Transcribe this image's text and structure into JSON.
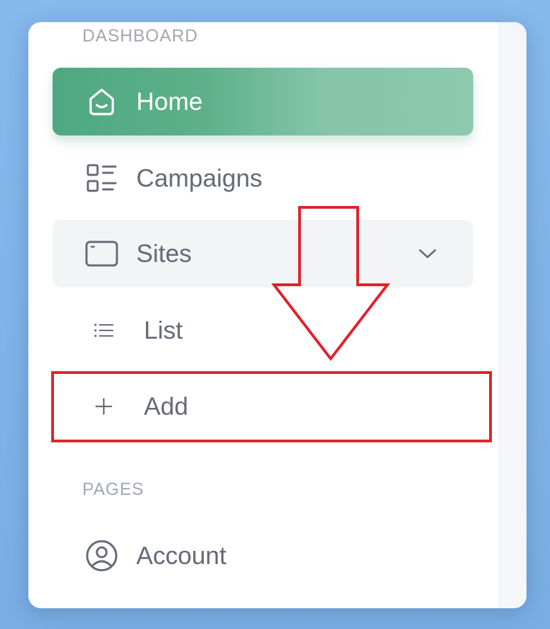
{
  "sidebar": {
    "sections": [
      {
        "label": "DASHBOARD"
      },
      {
        "label": "PAGES"
      }
    ],
    "items": [
      {
        "label": "Home",
        "icon": "home-icon",
        "active": true
      },
      {
        "label": "Campaigns",
        "icon": "campaigns-grid-icon",
        "active": false
      },
      {
        "label": "Sites",
        "icon": "browser-window-icon",
        "expanded": true
      },
      {
        "label": "Account",
        "icon": "user-circle-icon",
        "active": false
      }
    ],
    "sites_submenu": [
      {
        "label": "List",
        "icon": "list-icon"
      },
      {
        "label": "Add",
        "icon": "plus-icon"
      }
    ]
  },
  "colors": {
    "background": "#86b9ec",
    "active_gradient_start": "#4fa881",
    "active_gradient_end": "#8cc9ad",
    "text": "#656a78",
    "section_label": "#a3a7b1",
    "annotation": "#e1212a"
  },
  "annotation": {
    "highlight_target": "Add",
    "arrow": "down-arrow-outline"
  }
}
